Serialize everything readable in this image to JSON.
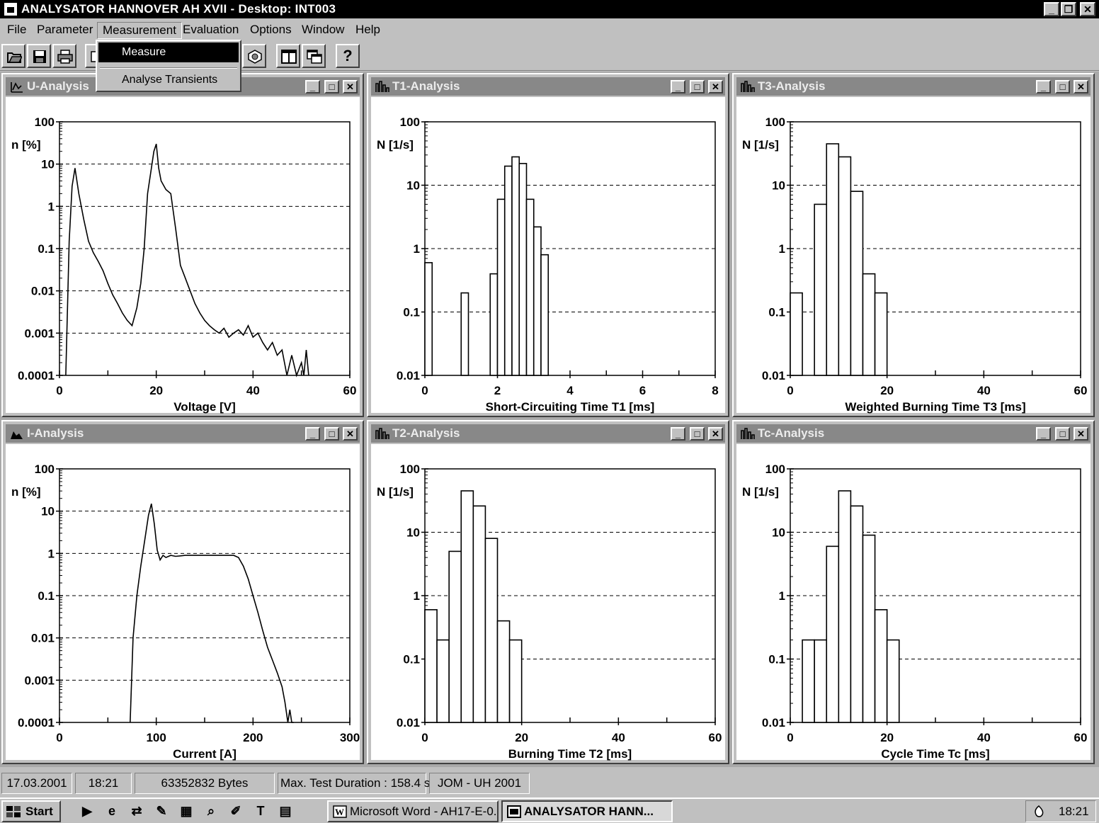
{
  "window": {
    "title": "ANALYSATOR HANNOVER AH  XVII - Desktop: INT003",
    "minimize_glyph": "_",
    "restore_glyph": "❐",
    "close_glyph": "✕"
  },
  "menu": {
    "items": [
      "File",
      "Parameter",
      "Measurement",
      "Evaluation",
      "Options",
      "Window",
      "Help"
    ],
    "open_menu": "Measurement",
    "dropdown": [
      "Measure",
      "Analyse Transients"
    ],
    "selected_item": "Measure"
  },
  "toolbar": {
    "icons": [
      "open-folder-icon",
      "save-icon",
      "print-icon",
      "measure-icon",
      "parameter-icon",
      "tile-windows-icon",
      "cascade-windows-icon",
      "help-icon"
    ],
    "help_glyph": "?"
  },
  "panels": [
    {
      "id": "u",
      "title": "U-Analysis"
    },
    {
      "id": "t1",
      "title": "T1-Analysis"
    },
    {
      "id": "t3",
      "title": "T3-Analysis"
    },
    {
      "id": "i",
      "title": "I-Analysis"
    },
    {
      "id": "t2",
      "title": "T2-Analysis"
    },
    {
      "id": "tc",
      "title": "Tc-Analysis"
    }
  ],
  "chart_data": [
    {
      "panel": "U-Analysis",
      "type": "line",
      "xlabel": "Voltage [V]",
      "ylabel": "n [%]",
      "xlim": [
        0,
        60
      ],
      "xticks": [
        0,
        20,
        40,
        60
      ],
      "xminor": 10,
      "ylim": [
        0.0001,
        100
      ],
      "yscale": "log",
      "yticks": [
        "0.0001",
        "0.001",
        "0.01",
        "0.1",
        "1",
        "10",
        "100"
      ],
      "grid": "horizontal-dashed",
      "x": [
        1.3,
        2,
        2.6,
        3.2,
        4,
        5,
        6,
        7,
        8,
        9,
        10,
        11,
        12,
        13,
        14,
        15,
        16,
        16.8,
        17.5,
        18.2,
        19,
        19.5,
        20,
        20.5,
        21,
        22,
        23,
        24,
        25,
        26,
        27,
        28,
        29,
        30,
        31,
        32,
        33,
        34,
        35,
        36,
        37,
        38,
        39,
        40,
        41,
        42,
        43,
        44,
        45,
        46,
        47,
        48,
        49,
        50,
        50.5,
        51,
        51.5
      ],
      "y": [
        0.0001,
        0.15,
        3,
        8,
        2,
        0.5,
        0.15,
        0.08,
        0.05,
        0.03,
        0.015,
        0.008,
        0.005,
        0.003,
        0.002,
        0.0015,
        0.004,
        0.015,
        0.1,
        2,
        8,
        20,
        30,
        8,
        4,
        2.5,
        2,
        0.3,
        0.04,
        0.02,
        0.01,
        0.005,
        0.003,
        0.002,
        0.0015,
        0.0012,
        0.001,
        0.0013,
        0.0008,
        0.001,
        0.0012,
        0.0009,
        0.0015,
        0.0008,
        0.001,
        0.0006,
        0.0004,
        0.0006,
        0.0003,
        0.0004,
        0.0001,
        0.0003,
        0.0001,
        0.0002,
        0.0001,
        0.0004,
        0.0001
      ]
    },
    {
      "panel": "T1-Analysis",
      "type": "bar",
      "xlabel": "Short-Circuiting Time T1 [ms]",
      "ylabel": "N [1/s]",
      "xlim": [
        0,
        8
      ],
      "xticks": [
        0,
        2,
        4,
        6,
        8
      ],
      "xminor": 1,
      "ylim": [
        0.01,
        100
      ],
      "yscale": "log",
      "yticks": [
        "0.01",
        "0.1",
        "1",
        "10",
        "100"
      ],
      "grid": "horizontal-dashed",
      "bin_width": 0.2,
      "bins": [
        [
          0,
          0.6
        ],
        [
          1,
          0.2
        ],
        [
          1.8,
          0.4
        ],
        [
          2,
          6
        ],
        [
          2.2,
          20
        ],
        [
          2.4,
          28
        ],
        [
          2.6,
          22
        ],
        [
          2.8,
          6
        ],
        [
          3,
          2.2
        ],
        [
          3.2,
          0.8
        ]
      ]
    },
    {
      "panel": "T3-Analysis",
      "type": "bar",
      "xlabel": "Weighted Burning Time T3 [ms]",
      "ylabel": "N [1/s]",
      "xlim": [
        0,
        60
      ],
      "xticks": [
        0,
        20,
        40,
        60
      ],
      "xminor": 10,
      "ylim": [
        0.01,
        100
      ],
      "yscale": "log",
      "yticks": [
        "0.01",
        "0.1",
        "1",
        "10",
        "100"
      ],
      "grid": "horizontal-dashed",
      "bin_width": 2.5,
      "bins": [
        [
          0,
          0.2
        ],
        [
          5,
          5
        ],
        [
          7.5,
          45
        ],
        [
          10,
          28
        ],
        [
          12.5,
          8
        ],
        [
          15,
          0.4
        ],
        [
          17.5,
          0.2
        ]
      ]
    },
    {
      "panel": "I-Analysis",
      "type": "line",
      "xlabel": "Current [A]",
      "ylabel": "n [%]",
      "xlim": [
        0,
        300
      ],
      "xticks": [
        0,
        100,
        200,
        300
      ],
      "xminor": 50,
      "ylim": [
        0.0001,
        100
      ],
      "yscale": "log",
      "yticks": [
        "0.0001",
        "0.001",
        "0.01",
        "0.1",
        "1",
        "10",
        "100"
      ],
      "grid": "horizontal-dashed",
      "x": [
        73,
        76,
        80,
        84,
        88,
        92,
        95,
        98,
        101,
        104,
        107,
        110,
        115,
        120,
        130,
        140,
        150,
        160,
        170,
        180,
        185,
        190,
        195,
        200,
        205,
        210,
        215,
        220,
        225,
        230,
        233,
        236,
        238,
        240,
        242
      ],
      "y": [
        0.0001,
        0.01,
        0.1,
        0.5,
        2,
        8,
        15,
        5,
        1.2,
        0.7,
        0.9,
        0.8,
        0.9,
        0.85,
        0.9,
        0.9,
        0.9,
        0.9,
        0.9,
        0.9,
        0.8,
        0.5,
        0.25,
        0.1,
        0.04,
        0.015,
        0.006,
        0.003,
        0.0015,
        0.0007,
        0.0003,
        0.0001,
        0.0002,
        0.0001,
        0.0001
      ]
    },
    {
      "panel": "T2-Analysis",
      "type": "bar",
      "xlabel": "Burning Time T2 [ms]",
      "ylabel": "N [1/s]",
      "xlim": [
        0,
        60
      ],
      "xticks": [
        0,
        20,
        40,
        60
      ],
      "xminor": 10,
      "ylim": [
        0.01,
        100
      ],
      "yscale": "log",
      "yticks": [
        "0.01",
        "0.1",
        "1",
        "10",
        "100"
      ],
      "grid": "horizontal-dashed",
      "bin_width": 2.5,
      "bins": [
        [
          0,
          0.6
        ],
        [
          2.5,
          0.2
        ],
        [
          5,
          5
        ],
        [
          7.5,
          45
        ],
        [
          10,
          26
        ],
        [
          12.5,
          8
        ],
        [
          15,
          0.4
        ],
        [
          17.5,
          0.2
        ]
      ]
    },
    {
      "panel": "Tc-Analysis",
      "type": "bar",
      "xlabel": "Cycle Time Tc [ms]",
      "ylabel": "N [1/s]",
      "xlim": [
        0,
        60
      ],
      "xticks": [
        0,
        20,
        40,
        60
      ],
      "xminor": 10,
      "ylim": [
        0.01,
        100
      ],
      "yscale": "log",
      "yticks": [
        "0.01",
        "0.1",
        "1",
        "10",
        "100"
      ],
      "grid": "horizontal-dashed",
      "bin_width": 2.5,
      "bins": [
        [
          2.5,
          0.2
        ],
        [
          5,
          0.2
        ],
        [
          7.5,
          6
        ],
        [
          10,
          45
        ],
        [
          12.5,
          26
        ],
        [
          15,
          9
        ],
        [
          17.5,
          0.6
        ],
        [
          20,
          0.2
        ]
      ]
    }
  ],
  "status": {
    "date": "17.03.2001",
    "time": "18:21",
    "bytes": "63352832 Bytes",
    "duration": "Max. Test Duration : 158.4 s",
    "copyright": "JOM - UH 2001"
  },
  "taskbar": {
    "start_label": "Start",
    "quick_launch": [
      "media-player-icon",
      "internet-explorer-icon",
      "network-icon",
      "notepad-icon",
      "calculator-icon",
      "search-icon",
      "paint-icon",
      "text-icon",
      "scheduler-icon"
    ],
    "tasks": [
      {
        "label": "Microsoft Word - AH17-E-0...",
        "icon": "word-icon",
        "active": false
      },
      {
        "label": "ANALYSATOR HANN...",
        "icon": "analysator-icon",
        "active": true
      }
    ],
    "clock": "18:21"
  }
}
